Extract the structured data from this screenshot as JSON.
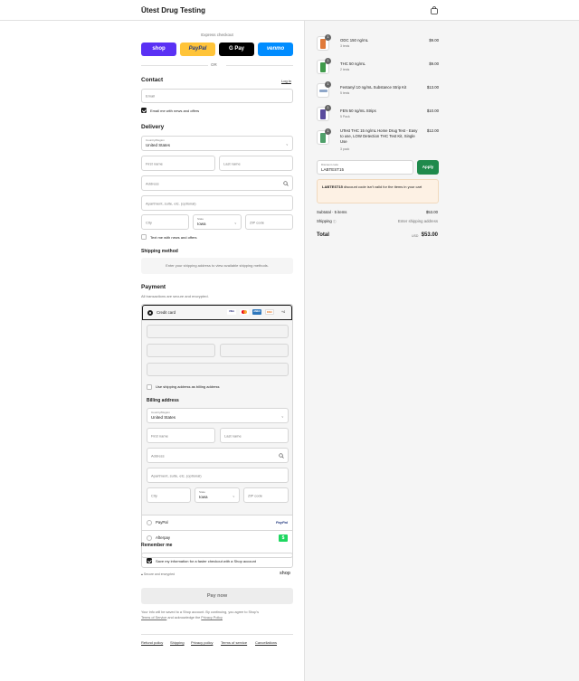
{
  "header": {
    "store_name": "Ūtest Drug Testing"
  },
  "express": {
    "title": "Express checkout",
    "buttons": [
      "shop",
      "PayPal",
      "G Pay",
      "venmo"
    ],
    "or": "OR"
  },
  "contact": {
    "title": "Contact",
    "login": "Log in",
    "email_placeholder": "Email",
    "news_label": "Email me with news and offers"
  },
  "delivery": {
    "title": "Delivery",
    "country_label": "Country/Region",
    "country_value": "United States",
    "first_name": "First name",
    "last_name": "Last name",
    "address": "Address",
    "apartment": "Apartment, suite, etc. (optional)",
    "city": "City",
    "state_label": "State",
    "state_value": "Iowa",
    "zip": "ZIP code",
    "text_label": "Text me with news and offers"
  },
  "shipping_method": {
    "title": "Shipping method",
    "message": "Enter your shipping address to view available shipping methods."
  },
  "payment": {
    "title": "Payment",
    "subtitle": "All transactions are secure and encrypted.",
    "credit_card": "Credit card",
    "card_logos": [
      "VISA",
      "MC",
      "AMEX",
      "DISC"
    ],
    "more_cards": "+4",
    "use_shipping": "Use shipping address as billing address",
    "billing_title": "Billing address",
    "paypal": "PayPal",
    "paypal_logo": "PayPal",
    "afterpay": "Afterpay",
    "afterpay_logo": "$"
  },
  "billing": {
    "country_label": "Country/Region",
    "country_value": "United States",
    "first_name": "First name",
    "last_name": "Last name",
    "address": "Address",
    "apartment": "Apartment, suite, etc. (optional)",
    "city": "City",
    "state_label": "State",
    "state_value": "Iowa",
    "zip": "ZIP code"
  },
  "remember": {
    "title": "Remember me",
    "save_label": "Save my information for a faster checkout with a Shop account",
    "secure": "Secure and encrypted",
    "shop_logo": "shop"
  },
  "pay_button": "Pay now",
  "legal": {
    "line1": "Your info will be saved to a Shop account. By continuing, you agree to Shop's",
    "tos": "Terms of Service",
    "and": "and acknowledge the",
    "privacy": "Privacy Policy"
  },
  "footer_links": [
    "Refund policy",
    "Shipping",
    "Privacy policy",
    "Terms of service",
    "Cancellations"
  ],
  "cart": {
    "items": [
      {
        "qty": "1",
        "name": "ODC 150 ng/mL",
        "sub": "3 tests",
        "price": "$9.00",
        "color": "#e07a3a"
      },
      {
        "qty": "1",
        "name": "THC 50 ng/mL",
        "sub": "2 tests",
        "price": "$9.00",
        "color": "#3f9a4a"
      },
      {
        "qty": "1",
        "name": "Fentanyl 10 ng/mL Substance Strip Kit",
        "sub": "5 tests",
        "price": "$13.00",
        "color": "#8fa7c9"
      },
      {
        "qty": "1",
        "name": "FEN 50 ng/mL Strips",
        "sub": "5 Pack",
        "price": "$10.00",
        "color": "#5a4c9e"
      },
      {
        "qty": "1",
        "name": "UTest THC 15 ng/mL Home Drug Test - Easy to use, LOW Detection THC Test Kit, Single Use",
        "sub": "3 pack",
        "price": "$12.00",
        "color": "#4fa06a"
      }
    ],
    "discount_label": "Discount code",
    "discount_value": "LABTEST15",
    "apply": "Apply",
    "discount_warning_code": "LABTEST15",
    "discount_warning_text": " discount code isn't valid for the items in your cart",
    "subtotal_label": "Subtotal · 5 items",
    "subtotal_value": "$53.00",
    "shipping_label": "Shipping",
    "shipping_value": "Enter shipping address",
    "total_label": "Total",
    "currency": "USD",
    "total_value": "$53.00"
  },
  "colors": {
    "shop": "#5a31f4",
    "paypal": "#ffc439",
    "gpay": "#000000",
    "venmo": "#008cff",
    "apply": "#1f8a4c",
    "warning_bg": "#fdf1e4"
  }
}
